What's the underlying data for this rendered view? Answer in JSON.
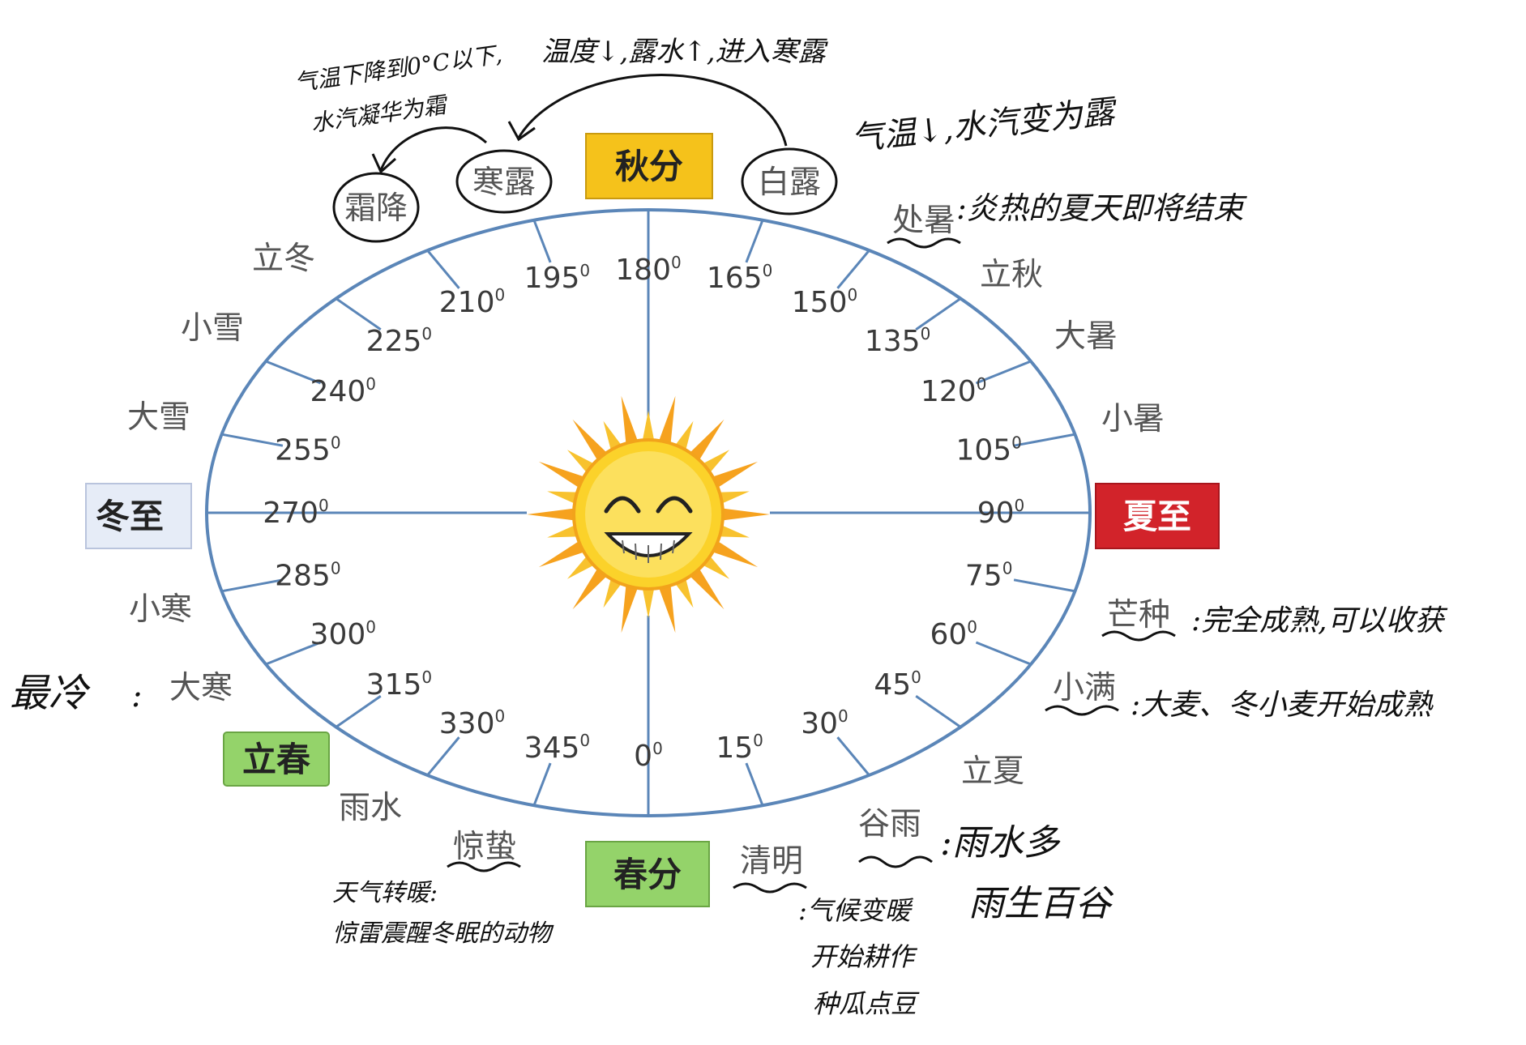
{
  "orbit": {
    "degrees": [
      "0",
      "15",
      "30",
      "45",
      "60",
      "75",
      "90",
      "105",
      "120",
      "135",
      "150",
      "165",
      "180",
      "195",
      "210",
      "225",
      "240",
      "255",
      "270",
      "285",
      "300",
      "315",
      "330",
      "345"
    ],
    "degree_symbol": "0"
  },
  "solar_terms": {
    "chunfen": "春分",
    "qingming": "清明",
    "guyu": "谷雨",
    "lixia": "立夏",
    "xiaoman": "小满",
    "mangzhong": "芒种",
    "xiazhi": "夏至",
    "xiaoshu": "小暑",
    "dashu": "大暑",
    "liqiu": "立秋",
    "chushu": "处暑",
    "bailu": "白露",
    "qiufen": "秋分",
    "hanlu": "寒露",
    "shuangjiang": "霜降",
    "lidong": "立冬",
    "xiaoxue": "小雪",
    "daxue": "大雪",
    "dongzhi": "冬至",
    "xiaohan": "小寒",
    "dahan": "大寒",
    "lichun": "立春",
    "yushui": "雨水",
    "jingzhe": "惊蛰"
  },
  "colors": {
    "orbit_line": "#5b86b8",
    "qiufen_box": "#f5c21b",
    "xiazhi_box": "#d2232a",
    "dongzhi_box": "#e6ecf7",
    "lichun_box": "#94d36a",
    "chunfen_box": "#94d36a",
    "sun": "#f6a21e",
    "ink": "#111111"
  },
  "annotations": {
    "shuangjiang_note_line1": "气温下降到0°C以下,",
    "shuangjiang_note_line2": "水汽凝华为霜",
    "hanlu_note": "温度↓,露水↑,进入寒露",
    "bailu_note": "气温↓,水汽变为露",
    "chushu_note": ":炎热的夏天即将结束",
    "mangzhong_note": ":完全成熟,可以收获",
    "xiaoman_note": ":大麦、冬小麦开始成熟",
    "dahan_note_left": "最冷",
    "dahan_note_colon": ":",
    "guyu_note_line1": ":雨水多",
    "guyu_note_line2": "雨生百谷",
    "jingzhe_note_line1": "天气转暖:",
    "jingzhe_note_line2": "惊雷震醒冬眠的动物",
    "qingming_note_line1": ":气候变暖",
    "qingming_note_line2": "开始耕作",
    "qingming_note_line3": "种瓜点豆"
  },
  "icons": {
    "sun": "smiling-sun-icon"
  }
}
